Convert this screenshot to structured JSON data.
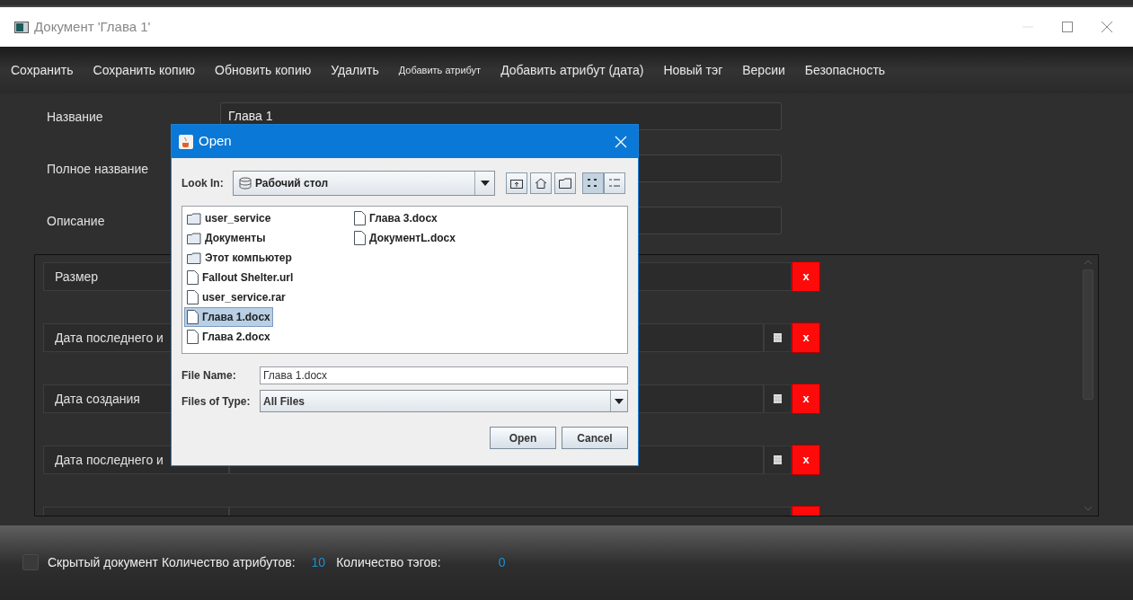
{
  "window": {
    "title": "Документ 'Глава 1'"
  },
  "menu": [
    {
      "label": "Сохранить",
      "kind": "normal"
    },
    {
      "label": "Сохранить копию",
      "kind": "normal"
    },
    {
      "label": "Обновить копию",
      "kind": "normal"
    },
    {
      "label": "Удалить",
      "kind": "normal"
    },
    {
      "label": "Добавить атрибут",
      "kind": "compact"
    },
    {
      "label": "Добавить атрибут (дата)",
      "kind": "normal"
    },
    {
      "label": "Новый тэг",
      "kind": "normal"
    },
    {
      "label": "Версии",
      "kind": "normal"
    },
    {
      "label": "Безопасность",
      "kind": "normal"
    }
  ],
  "fields": [
    {
      "label": "Название",
      "value": "Глава 1"
    },
    {
      "label": "Полное название"
    },
    {
      "label": "Описание"
    }
  ],
  "attributes": [
    {
      "label": "Размер",
      "kind": "text",
      "delete": "x"
    },
    {
      "label": "Дата последнего и",
      "kind": "date",
      "delete": "x"
    },
    {
      "label": "Дата создания",
      "kind": "date",
      "delete": "x"
    },
    {
      "label": "Дата последнего и",
      "kind": "date",
      "delete": "x"
    },
    {
      "kind": "text"
    }
  ],
  "status": {
    "hidden_label": "Скрытый документ",
    "hidden_checked": false,
    "attr_label": "Количество атрибутов:",
    "attr_count": "10",
    "tag_label": "Количество тэгов:",
    "tag_count": "0"
  },
  "dialog": {
    "title": "Open",
    "look_in_label": "Look In:",
    "look_in": "Рабочий стол",
    "columns": [
      [
        {
          "name": "user_service",
          "kind": "folder",
          "selected": false
        },
        {
          "name": "Документы",
          "kind": "folder",
          "selected": false
        },
        {
          "name": "Этот компьютер",
          "kind": "folder",
          "selected": false
        },
        {
          "name": "Fallout Shelter.url",
          "kind": "file",
          "selected": false
        },
        {
          "name": "user_service.rar",
          "kind": "file",
          "selected": false
        },
        {
          "name": "Глава 1.docx",
          "kind": "file",
          "selected": true
        },
        {
          "name": "Глава 2.docx",
          "kind": "file",
          "selected": false
        }
      ],
      [
        {
          "name": "Глава 3.docx",
          "kind": "file",
          "selected": false
        },
        {
          "name": "ДокументL.docx",
          "kind": "file",
          "selected": false
        }
      ]
    ],
    "file_name_label": "File Name:",
    "file_name": "Глава 1.docx",
    "type_label": "Files of Type:",
    "type": "All Files",
    "buttons": [
      "Open",
      "Cancel"
    ]
  }
}
